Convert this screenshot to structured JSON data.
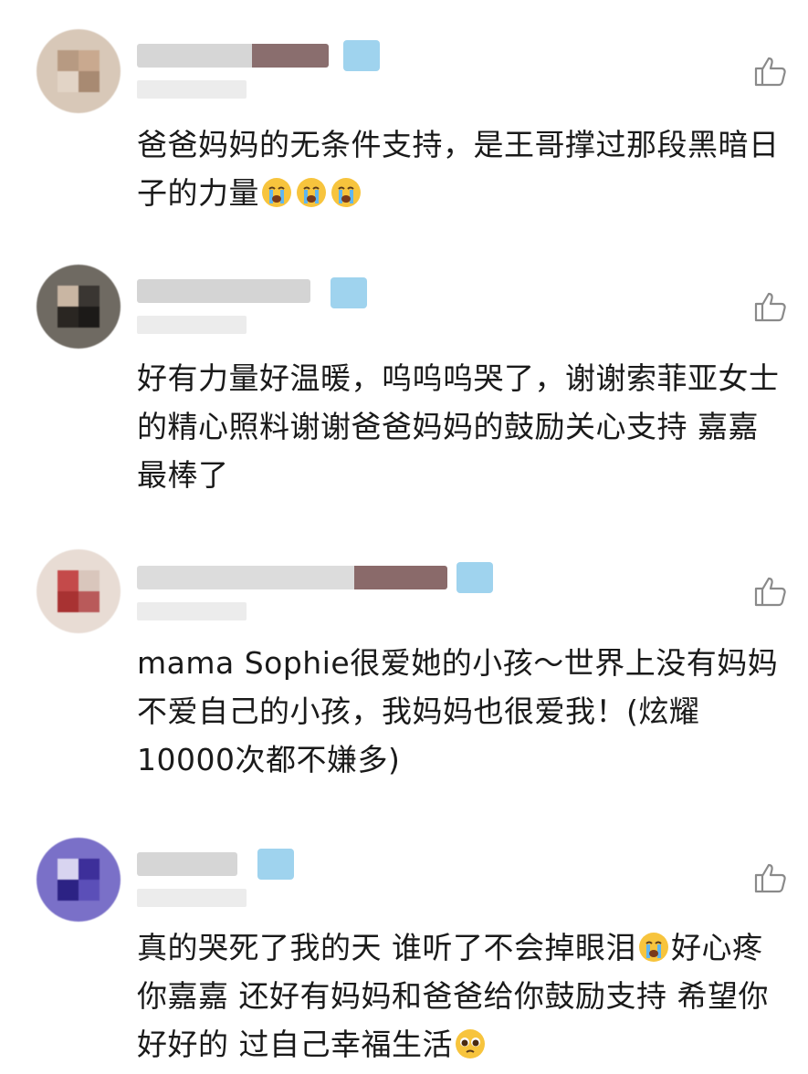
{
  "comments": [
    {
      "text": "爸爸妈妈的无条件支持，是王哥撑过那段黑暗日子的力量",
      "emojis": [
        "loudly-crying-face",
        "loudly-crying-face",
        "loudly-crying-face"
      ]
    },
    {
      "text": "好有力量好温暖，呜呜呜哭了，谢谢索菲亚女士的精心照料谢谢爸爸妈妈的鼓励关心支持 嘉嘉最棒了",
      "emojis": []
    },
    {
      "text": "mama Sophie很爱她的小孩～世界上没有妈妈不爱自己的小孩，我妈妈也很爱我！(炫耀10000次都不嫌多)",
      "emojis": []
    },
    {
      "text_before": "真的哭死了我的天 谁听了不会掉眼泪",
      "text_after": "好心疼你嘉嘉  还好有妈妈和爸爸给你鼓励支持 希望你好好的 过自己幸福生活",
      "emojis": [
        "loudly-crying-face",
        "pleading-face"
      ]
    }
  ],
  "icons": {
    "like": "thumbs-up-icon"
  },
  "colors": {
    "badge": "#9fd3ee",
    "icon_stroke": "#8a8a8a"
  }
}
